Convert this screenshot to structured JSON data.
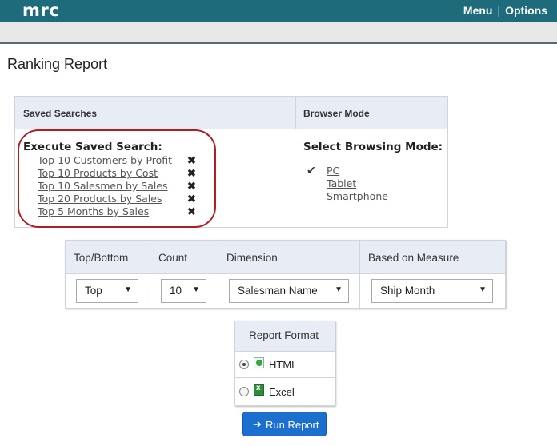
{
  "app": {
    "logo": "mrc"
  },
  "topnav": {
    "menu": "Menu",
    "separator": "|",
    "options": "Options"
  },
  "page": {
    "title": "Ranking Report"
  },
  "saved_panel": {
    "header_saved": "Saved Searches",
    "header_browser": "Browser Mode",
    "execute_title": "Execute Saved Search:",
    "searches": [
      {
        "label": "Top 10 Customers by Profit"
      },
      {
        "label": "Top 10 Products by Cost"
      },
      {
        "label": "Top 10 Salesmen by Sales"
      },
      {
        "label": "Top 20 Products by Sales"
      },
      {
        "label": "Top 5 Months by Sales"
      }
    ],
    "delete_icon": "✖",
    "browse_title": "Select Browsing Mode:",
    "check_icon": "✔",
    "modes": [
      {
        "label": "PC",
        "selected": true
      },
      {
        "label": "Tablet",
        "selected": false
      },
      {
        "label": "Smartphone",
        "selected": false
      }
    ]
  },
  "params": {
    "headers": {
      "top_bottom": "Top/Bottom",
      "count": "Count",
      "dimension": "Dimension",
      "measure": "Based on Measure"
    },
    "values": {
      "top_bottom": "Top",
      "count": "10",
      "dimension": "Salesman Name",
      "measure": "Ship Month"
    },
    "arrow": "▼"
  },
  "format": {
    "header": "Report Format",
    "options": [
      {
        "label": "HTML",
        "selected": true,
        "icon": "html-file-icon"
      },
      {
        "label": "Excel",
        "selected": false,
        "icon": "excel-file-icon"
      }
    ]
  },
  "run_button": {
    "icon": "➔",
    "label": "Run Report",
    "color": "#1b6fce"
  },
  "colors": {
    "topbar": "#1d6b7b",
    "highlight_oval": "#b01e23",
    "panel_header": "#e8edf5"
  }
}
